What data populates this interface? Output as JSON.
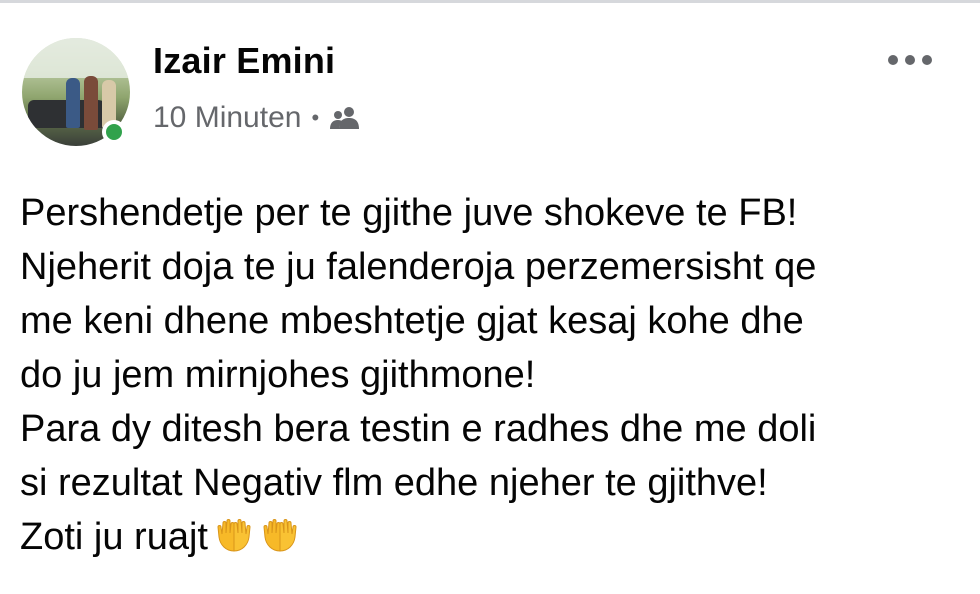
{
  "post": {
    "author_name": "Izair Emini",
    "timestamp": "10 Minuten",
    "separator": "•",
    "audience_icon": "friends-icon",
    "more_icon": "more-horizontal-icon",
    "body_lines": [
      "Pershendetje per te gjithe juve shokeve te FB!",
      "Njeherit doja te ju falenderoja perzemersisht qe",
      "me keni dhene mbeshtetje gjat kesaj kohe dhe",
      "do ju jem mirnjohes gjithmone!",
      "Para dy ditesh bera testin e radhes dhe me doli",
      "si rezultat Negativ flm edhe njeher te gjithve!",
      "Zoti ju ruajt"
    ],
    "emojis": [
      "folded-hands-emoji",
      "folded-hands-emoji"
    ]
  },
  "colors": {
    "name": "#050505",
    "meta": "#65676b",
    "online": "#31a24c",
    "emoji": "#f7b928"
  }
}
